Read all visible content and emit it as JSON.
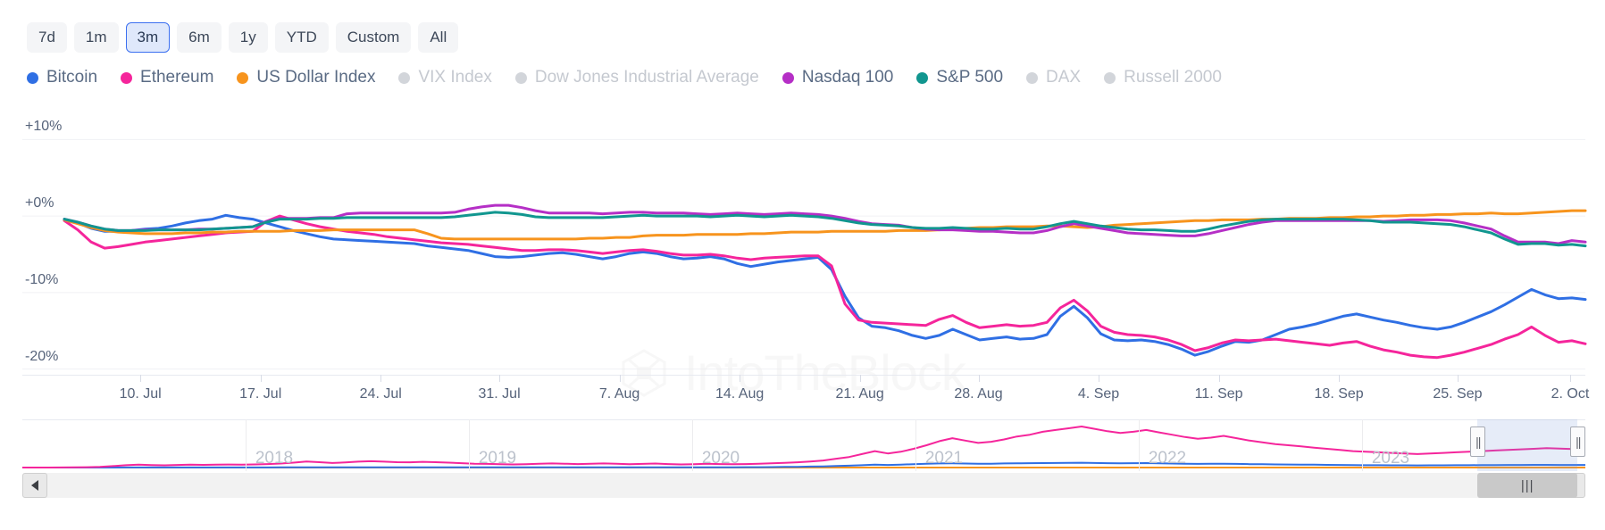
{
  "range_selector": {
    "options": [
      {
        "label": "7d",
        "active": false
      },
      {
        "label": "1m",
        "active": false
      },
      {
        "label": "3m",
        "active": true
      },
      {
        "label": "6m",
        "active": false
      },
      {
        "label": "1y",
        "active": false
      },
      {
        "label": "YTD",
        "active": false
      },
      {
        "label": "Custom",
        "active": false
      },
      {
        "label": "All",
        "active": false
      }
    ]
  },
  "watermark": {
    "text": "IntoTheBlock"
  },
  "navigator": {
    "years": [
      "2018",
      "2019",
      "2020",
      "2021",
      "2022",
      "2023"
    ],
    "handle_glyph": "||",
    "thumb_glyph": "|||",
    "left_arrow_icon": "left-arrow-icon",
    "right_arrow_icon": "right-arrow-icon",
    "selection_start_pct": 93.1,
    "selection_end_pct": 99.5
  },
  "chart_data": {
    "type": "line",
    "title": "",
    "xlabel": "",
    "ylabel": "",
    "ylim": [
      -22.5,
      12.5
    ],
    "grid": true,
    "legend_position": "top",
    "ytick_labels": [
      "+10%",
      "+0%",
      "-10%",
      "-20%"
    ],
    "ytick_values": [
      10,
      0,
      -10,
      -20
    ],
    "xtick_labels": [
      "10. Jul",
      "17. Jul",
      "24. Jul",
      "31. Jul",
      "7. Aug",
      "14. Aug",
      "21. Aug",
      "28. Aug",
      "4. Sep",
      "11. Sep",
      "18. Sep",
      "25. Sep",
      "2. Oct"
    ],
    "xtick_positions_pct": [
      5.0,
      12.9,
      20.8,
      28.6,
      36.5,
      44.4,
      52.3,
      60.1,
      68.0,
      75.9,
      83.8,
      91.6,
      99.0
    ],
    "series": [
      {
        "name": "Bitcoin",
        "color": "#2f6fe4",
        "visible": true,
        "values": [
          -0.4,
          -0.9,
          -1.6,
          -2.0,
          -2.0,
          -1.9,
          -1.7,
          -1.6,
          -1.3,
          -0.9,
          -0.6,
          -0.4,
          0.1,
          -0.2,
          -0.4,
          -0.9,
          -1.4,
          -1.9,
          -2.3,
          -2.7,
          -3.0,
          -3.1,
          -3.2,
          -3.3,
          -3.4,
          -3.5,
          -3.6,
          -3.9,
          -4.1,
          -4.3,
          -4.5,
          -4.9,
          -5.3,
          -5.4,
          -5.3,
          -5.1,
          -4.9,
          -4.8,
          -5.0,
          -5.3,
          -5.6,
          -5.3,
          -4.9,
          -4.7,
          -4.9,
          -5.3,
          -5.6,
          -5.5,
          -5.3,
          -5.6,
          -6.2,
          -6.6,
          -6.3,
          -6.0,
          -5.8,
          -5.6,
          -5.4,
          -7.0,
          -10.5,
          -13.3,
          -14.4,
          -14.6,
          -15.0,
          -15.6,
          -16.0,
          -15.6,
          -14.8,
          -15.5,
          -16.2,
          -16.0,
          -15.8,
          -16.1,
          -16.0,
          -15.5,
          -13.1,
          -11.8,
          -13.3,
          -15.4,
          -16.2,
          -16.3,
          -16.2,
          -16.4,
          -16.8,
          -17.4,
          -18.2,
          -17.7,
          -17.0,
          -16.4,
          -16.5,
          -16.2,
          -15.5,
          -14.8,
          -14.5,
          -14.1,
          -13.6,
          -13.1,
          -12.8,
          -13.2,
          -13.6,
          -13.9,
          -14.3,
          -14.6,
          -14.8,
          -14.5,
          -13.9,
          -13.2,
          -12.5,
          -11.6,
          -10.6,
          -9.6,
          -10.3,
          -10.8,
          -10.7,
          -10.9
        ],
        "last_value": -10.9
      },
      {
        "name": "Ethereum",
        "color": "#f5259b",
        "visible": true,
        "values": [
          -0.6,
          -1.8,
          -3.4,
          -4.2,
          -4.0,
          -3.7,
          -3.4,
          -3.2,
          -3.0,
          -2.8,
          -2.6,
          -2.4,
          -2.2,
          -2.1,
          -2.0,
          -0.7,
          0.0,
          -0.5,
          -1.0,
          -1.4,
          -1.7,
          -2.0,
          -2.2,
          -2.4,
          -2.7,
          -2.9,
          -3.1,
          -3.3,
          -3.5,
          -3.6,
          -3.7,
          -3.9,
          -4.1,
          -4.3,
          -4.5,
          -4.5,
          -4.4,
          -4.4,
          -4.5,
          -4.7,
          -4.9,
          -4.7,
          -4.5,
          -4.4,
          -4.6,
          -4.9,
          -5.1,
          -5.1,
          -5.0,
          -5.2,
          -5.5,
          -5.7,
          -5.5,
          -5.4,
          -5.3,
          -5.2,
          -5.2,
          -6.5,
          -11.5,
          -13.6,
          -13.9,
          -14.0,
          -14.1,
          -14.2,
          -14.3,
          -13.5,
          -13.0,
          -13.9,
          -14.6,
          -14.4,
          -14.2,
          -14.4,
          -14.3,
          -13.9,
          -12.0,
          -11.0,
          -12.4,
          -14.4,
          -15.2,
          -15.5,
          -15.6,
          -15.8,
          -16.2,
          -16.8,
          -17.6,
          -17.2,
          -16.6,
          -16.2,
          -16.3,
          -16.2,
          -16.1,
          -16.3,
          -16.5,
          -16.7,
          -16.9,
          -16.6,
          -16.4,
          -17.0,
          -17.5,
          -17.8,
          -18.2,
          -18.4,
          -18.5,
          -18.2,
          -17.8,
          -17.3,
          -16.8,
          -16.1,
          -15.5,
          -14.5,
          -15.6,
          -16.5,
          -16.3,
          -16.7
        ],
        "last_value": -16.7
      },
      {
        "name": "US Dollar Index",
        "color": "#f7941d",
        "visible": true,
        "values": [
          -0.5,
          -1.0,
          -1.5,
          -1.9,
          -2.1,
          -2.2,
          -2.3,
          -2.3,
          -2.3,
          -2.2,
          -2.2,
          -2.1,
          -2.1,
          -2.0,
          -2.0,
          -2.0,
          -2.0,
          -1.9,
          -1.9,
          -1.9,
          -1.8,
          -1.8,
          -1.8,
          -1.8,
          -1.8,
          -1.8,
          -1.8,
          -2.3,
          -2.9,
          -3.0,
          -3.0,
          -3.0,
          -3.0,
          -3.0,
          -3.0,
          -3.0,
          -3.0,
          -3.0,
          -3.0,
          -2.9,
          -2.9,
          -2.8,
          -2.8,
          -2.6,
          -2.5,
          -2.5,
          -2.5,
          -2.4,
          -2.4,
          -2.4,
          -2.4,
          -2.3,
          -2.3,
          -2.2,
          -2.1,
          -2.1,
          -2.1,
          -2.0,
          -2.0,
          -2.0,
          -2.0,
          -2.0,
          -1.9,
          -1.9,
          -1.9,
          -1.8,
          -1.7,
          -1.6,
          -1.5,
          -1.5,
          -1.4,
          -1.4,
          -1.4,
          -1.3,
          -1.3,
          -1.4,
          -1.5,
          -1.4,
          -1.2,
          -1.1,
          -1.0,
          -0.9,
          -0.8,
          -0.7,
          -0.6,
          -0.6,
          -0.5,
          -0.5,
          -0.5,
          -0.4,
          -0.4,
          -0.3,
          -0.3,
          -0.3,
          -0.2,
          -0.2,
          -0.1,
          -0.1,
          0.0,
          0.0,
          0.1,
          0.1,
          0.2,
          0.2,
          0.3,
          0.3,
          0.4,
          0.3,
          0.3,
          0.4,
          0.5,
          0.6,
          0.7,
          0.7
        ],
        "last_value": 0.7
      },
      {
        "name": "VIX Index",
        "color": "#d2d5da",
        "visible": false,
        "values": [],
        "last_value": null
      },
      {
        "name": "Dow Jones Industrial Average",
        "color": "#d2d5da",
        "visible": false,
        "values": [],
        "last_value": null
      },
      {
        "name": "Nasdaq 100",
        "color": "#b52fc6",
        "visible": true,
        "values": [
          -0.4,
          -0.8,
          -1.3,
          -1.7,
          -1.9,
          -1.9,
          -1.8,
          -1.8,
          -1.8,
          -1.8,
          -1.7,
          -1.7,
          -1.6,
          -1.5,
          -1.4,
          -0.7,
          -0.3,
          -0.3,
          -0.3,
          -0.2,
          -0.2,
          0.3,
          0.4,
          0.4,
          0.4,
          0.4,
          0.4,
          0.4,
          0.4,
          0.5,
          0.9,
          1.2,
          1.4,
          1.4,
          1.1,
          0.7,
          0.4,
          0.4,
          0.4,
          0.4,
          0.3,
          0.4,
          0.5,
          0.5,
          0.4,
          0.4,
          0.4,
          0.3,
          0.2,
          0.3,
          0.4,
          0.3,
          0.2,
          0.3,
          0.4,
          0.3,
          0.2,
          0.0,
          -0.3,
          -0.7,
          -1.0,
          -1.1,
          -1.2,
          -1.5,
          -1.7,
          -1.8,
          -1.8,
          -1.9,
          -2.0,
          -2.0,
          -2.1,
          -2.2,
          -2.2,
          -1.9,
          -1.4,
          -1.0,
          -1.3,
          -1.6,
          -1.9,
          -2.2,
          -2.3,
          -2.4,
          -2.5,
          -2.6,
          -2.6,
          -2.3,
          -1.9,
          -1.5,
          -1.1,
          -0.8,
          -0.6,
          -0.6,
          -0.6,
          -0.6,
          -0.6,
          -0.6,
          -0.6,
          -0.6,
          -0.7,
          -0.6,
          -0.5,
          -0.5,
          -0.5,
          -0.6,
          -0.9,
          -1.3,
          -1.7,
          -2.6,
          -3.4,
          -3.4,
          -3.4,
          -3.6,
          -3.2,
          -3.4
        ],
        "last_value": -3.4
      },
      {
        "name": "S&P 500",
        "color": "#11968f",
        "visible": true,
        "values": [
          -0.4,
          -0.8,
          -1.3,
          -1.7,
          -1.9,
          -1.9,
          -1.9,
          -1.8,
          -1.8,
          -1.8,
          -1.8,
          -1.7,
          -1.6,
          -1.5,
          -1.4,
          -0.8,
          -0.4,
          -0.4,
          -0.4,
          -0.3,
          -0.3,
          -0.2,
          -0.2,
          -0.2,
          -0.2,
          -0.2,
          -0.2,
          -0.2,
          -0.2,
          -0.1,
          0.1,
          0.3,
          0.5,
          0.4,
          0.2,
          -0.1,
          -0.2,
          -0.2,
          -0.2,
          -0.2,
          -0.2,
          -0.1,
          0.0,
          0.1,
          0.0,
          0.0,
          0.0,
          0.0,
          -0.1,
          0.0,
          0.1,
          0.0,
          -0.1,
          0.0,
          0.1,
          0.0,
          -0.1,
          -0.3,
          -0.6,
          -0.9,
          -1.1,
          -1.2,
          -1.3,
          -1.5,
          -1.6,
          -1.6,
          -1.5,
          -1.6,
          -1.7,
          -1.7,
          -1.6,
          -1.7,
          -1.7,
          -1.4,
          -1.0,
          -0.7,
          -1.0,
          -1.3,
          -1.5,
          -1.7,
          -1.8,
          -1.8,
          -1.9,
          -2.0,
          -2.0,
          -1.7,
          -1.3,
          -1.0,
          -0.7,
          -0.5,
          -0.4,
          -0.4,
          -0.4,
          -0.4,
          -0.4,
          -0.4,
          -0.5,
          -0.6,
          -0.8,
          -0.8,
          -0.8,
          -0.9,
          -1.0,
          -1.1,
          -1.4,
          -1.8,
          -2.2,
          -3.0,
          -3.7,
          -3.6,
          -3.6,
          -3.8,
          -3.7,
          -3.9
        ],
        "last_value": -3.9
      },
      {
        "name": "DAX",
        "color": "#d2d5da",
        "visible": false,
        "values": [],
        "last_value": null
      },
      {
        "name": "Russell 2000",
        "color": "#d2d5da",
        "visible": false,
        "values": [],
        "last_value": null
      }
    ],
    "navigator_series": [
      {
        "name": "Ethereum",
        "color": "#f5259b",
        "values": [
          0,
          0,
          0,
          0.1,
          0.2,
          0.3,
          0.6,
          1.2,
          2.0,
          2.4,
          2.1,
          1.9,
          2.2,
          2.5,
          2.3,
          2.4,
          2.6,
          2.5,
          2.7,
          3.0,
          3.4,
          4.2,
          5.2,
          4.6,
          3.9,
          4.3,
          5.0,
          5.4,
          5.0,
          4.6,
          4.5,
          4.9,
          4.6,
          4.2,
          3.7,
          3.3,
          3.1,
          2.9,
          2.7,
          2.9,
          3.3,
          3.5,
          3.3,
          3.0,
          3.2,
          3.5,
          3.2,
          2.9,
          3.1,
          3.4,
          3.0,
          2.7,
          2.9,
          3.2,
          3.0,
          2.8,
          3.0,
          3.3,
          3.6,
          4.0,
          4.5,
          5.2,
          6.0,
          7.5,
          9.0,
          11.5,
          14.0,
          12.0,
          13.5,
          16.0,
          19.0,
          22.5,
          25.0,
          23.0,
          21.0,
          22.0,
          24.0,
          26.5,
          28.0,
          30.5,
          32.0,
          33.5,
          35.0,
          33.0,
          31.0,
          29.5,
          30.5,
          32.0,
          30.0,
          28.0,
          26.0,
          24.5,
          25.5,
          27.0,
          25.0,
          23.0,
          21.5,
          20.0,
          19.0,
          18.0,
          17.0,
          16.0,
          15.0,
          14.0,
          13.5,
          13.0,
          12.5,
          12.0,
          11.5,
          12.0,
          12.5,
          13.0,
          13.5,
          14.0,
          14.5,
          15.0,
          15.5,
          16.0,
          16.5,
          16.2,
          15.8,
          15.5
        ]
      },
      {
        "name": "Bitcoin",
        "color": "#2f6fe4",
        "values": [
          0,
          0,
          0,
          0,
          0,
          0,
          0,
          0,
          0.1,
          0.1,
          0.1,
          0.1,
          0.1,
          0.1,
          0.1,
          0.1,
          0.1,
          0.1,
          0.1,
          0.1,
          0.2,
          0.2,
          0.2,
          0.2,
          0.2,
          0.2,
          0.2,
          0.2,
          0.2,
          0.2,
          0.2,
          0.2,
          0.2,
          0.2,
          0.2,
          0.2,
          0.2,
          0.2,
          0.2,
          0.2,
          0.2,
          0.2,
          0.2,
          0.2,
          0.2,
          0.2,
          0.2,
          0.2,
          0.2,
          0.2,
          0.2,
          0.2,
          0.2,
          0.2,
          0.2,
          0.2,
          0.3,
          0.3,
          0.4,
          0.5,
          0.6,
          0.8,
          1.0,
          1.3,
          1.6,
          2.0,
          2.4,
          2.2,
          2.5,
          2.9,
          3.2,
          3.5,
          3.6,
          3.4,
          3.2,
          3.3,
          3.5,
          3.6,
          3.7,
          3.8,
          3.9,
          4.0,
          4.1,
          3.9,
          3.7,
          3.6,
          3.7,
          3.8,
          3.6,
          3.4,
          3.2,
          3.1,
          3.2,
          3.3,
          3.1,
          2.9,
          2.8,
          2.7,
          2.6,
          2.5,
          2.4,
          2.3,
          2.2,
          2.1,
          2.0,
          2.0,
          1.9,
          1.9,
          1.8,
          1.9,
          1.9,
          2.0,
          2.0,
          2.1,
          2.1,
          2.2,
          2.2,
          2.3,
          2.3,
          2.2,
          2.2,
          2.2
        ]
      },
      {
        "name": "US Dollar Index",
        "color": "#f7941d",
        "values": [
          0,
          0,
          0,
          0,
          0,
          0,
          0,
          0,
          0,
          0,
          0,
          0,
          0,
          0,
          0,
          0,
          0,
          0,
          0,
          0,
          0,
          0,
          0,
          0,
          0,
          0,
          0,
          0,
          0,
          0,
          0,
          0,
          0,
          0,
          0,
          0,
          0,
          0,
          0,
          0,
          0,
          0,
          0,
          0,
          0,
          0,
          0,
          0,
          0,
          0,
          0,
          0,
          0,
          0,
          0,
          0,
          0,
          0,
          0,
          0,
          0,
          0,
          0,
          0,
          0,
          0,
          0,
          0,
          0,
          0,
          0,
          0,
          0,
          0,
          0,
          0,
          0,
          0,
          0,
          0,
          0,
          0,
          0,
          0,
          0,
          0,
          0,
          0,
          0,
          0,
          0,
          0,
          0,
          0,
          0,
          0,
          0,
          0,
          0,
          0,
          0,
          0,
          0,
          0,
          0,
          0,
          0,
          0,
          0,
          0,
          0,
          0,
          0,
          0,
          0,
          0,
          0,
          0,
          0,
          0
        ]
      }
    ]
  }
}
